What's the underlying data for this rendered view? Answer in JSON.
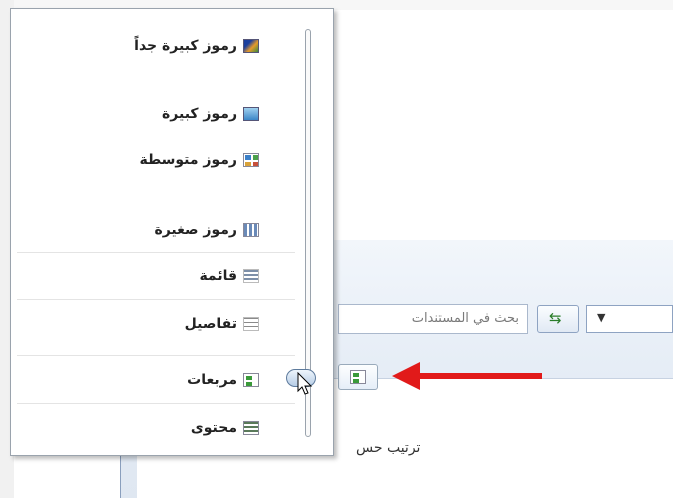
{
  "menu": {
    "items": [
      {
        "label": "رموز كبيرة جداً",
        "icon": "extra-large-icons-icon"
      },
      {
        "label": "رموز كبيرة",
        "icon": "large-icons-icon"
      },
      {
        "label": "رموز متوسطة",
        "icon": "medium-icons-icon"
      },
      {
        "label": "رموز صغيرة",
        "icon": "small-icons-icon"
      },
      {
        "label": "قائمة",
        "icon": "list-view-icon"
      },
      {
        "label": "تفاصيل",
        "icon": "details-view-icon"
      },
      {
        "label": "مربعات",
        "icon": "tiles-view-icon"
      },
      {
        "label": "محتوى",
        "icon": "content-view-icon"
      }
    ],
    "selected": "مربعات"
  },
  "explorer": {
    "search_placeholder": "بحث في المستندات",
    "sort_label": "ترتيب حس"
  },
  "colors": {
    "arrow": "#e11a1a"
  }
}
